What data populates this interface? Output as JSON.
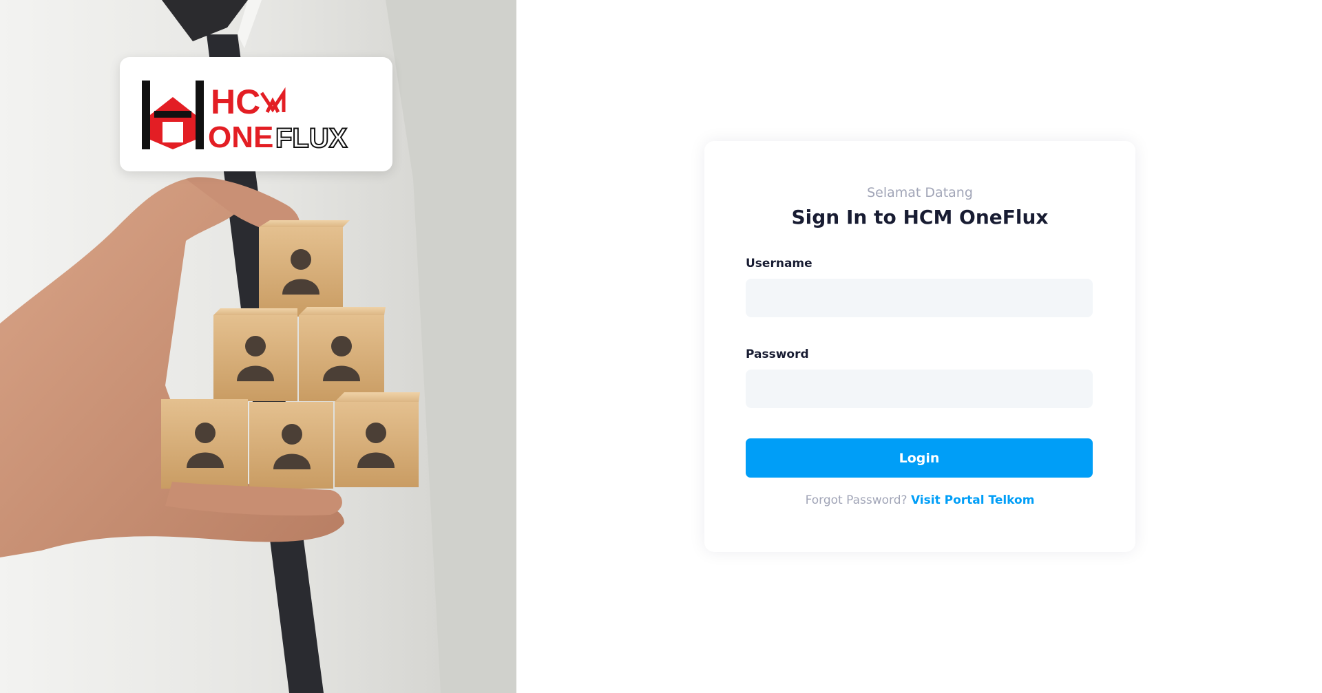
{
  "brand": {
    "logo_line1": "HCM",
    "logo_line2": "ONEFLUX",
    "accent_red": "#e31e24",
    "accent_blue": "#009ef7"
  },
  "hero": {
    "image_icon": "person-blocks-icon"
  },
  "login": {
    "welcome": "Selamat Datang",
    "title": "Sign In to HCM OneFlux",
    "username_label": "Username",
    "username_value": "",
    "password_label": "Password",
    "password_value": "",
    "login_label": "Login",
    "forgot_text": "Forgot Password?",
    "portal_link": "Visit Portal Telkom"
  }
}
